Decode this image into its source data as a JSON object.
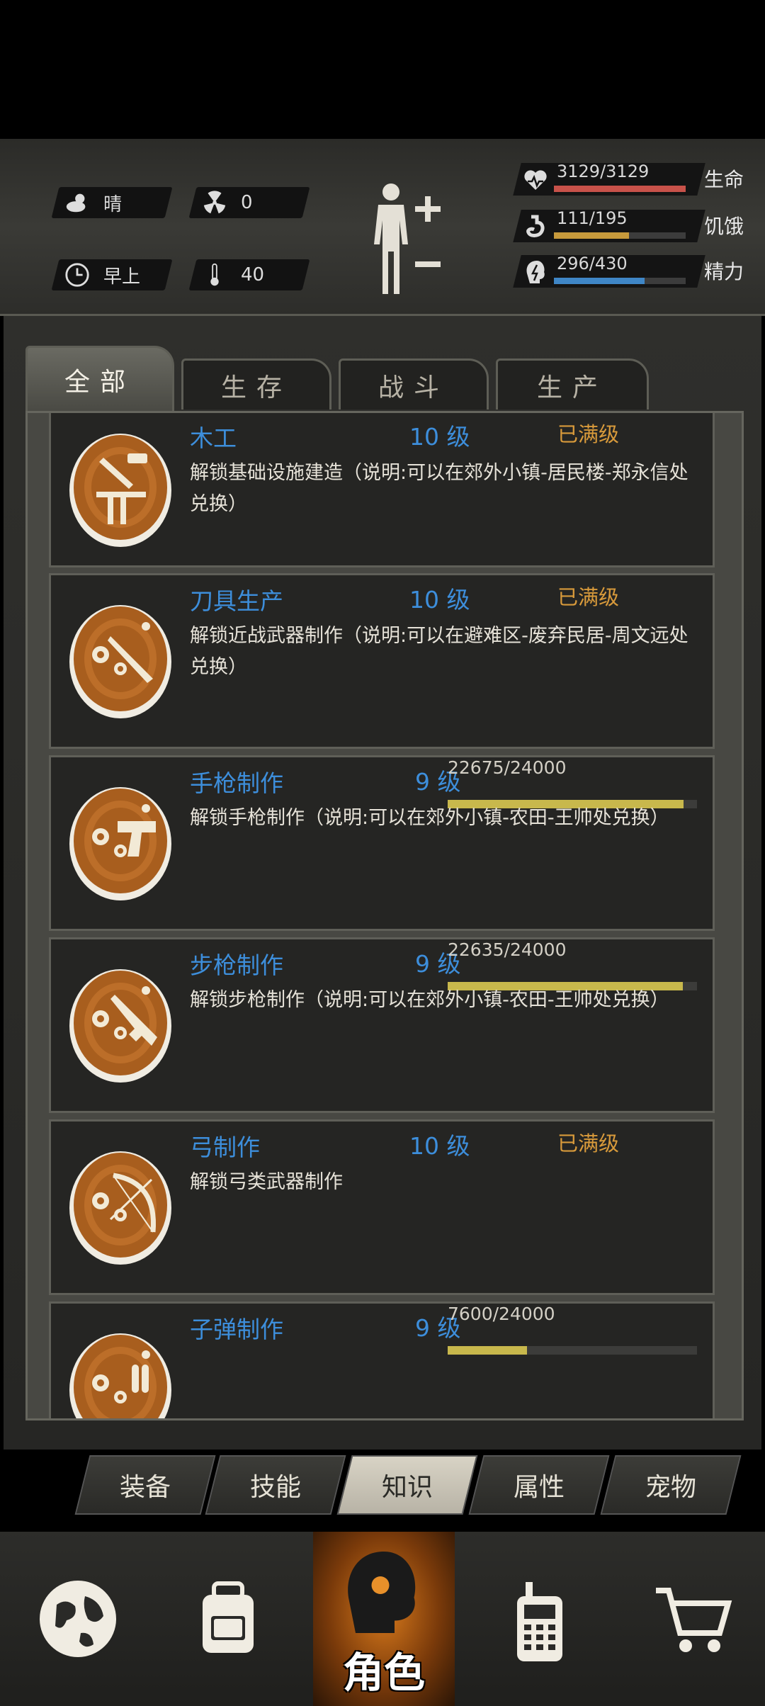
{
  "header": {
    "weather": "晴",
    "radiation": "0",
    "time_of_day": "早上",
    "temperature": "40",
    "stats": [
      {
        "icon": "heart-icon",
        "value": "3129/3129",
        "label": "生命",
        "fraction": 1.0,
        "color": "#c8524a"
      },
      {
        "icon": "stomach-icon",
        "value": "111/195",
        "label": "饥饿",
        "fraction": 0.569,
        "color": "#c79a3c"
      },
      {
        "icon": "energy-icon",
        "value": "296/430",
        "label": "精力",
        "fraction": 0.688,
        "color": "#3f86c6"
      }
    ]
  },
  "tabs": [
    "全部",
    "生存",
    "战斗",
    "生产"
  ],
  "active_tab": "全部",
  "skills": [
    {
      "name": "木工",
      "level": "10 级",
      "status": "已满级",
      "desc": "解锁基础设施建造（说明:可以在郊外小镇-居民楼-郑永信处兑换）",
      "icon": "carpentry-icon"
    },
    {
      "name": "刀具生产",
      "level": "10 级",
      "status": "已满级",
      "desc": "解锁近战武器制作（说明:可以在避难区-废弃民居-周文远处兑换）",
      "icon": "knife-crafting-icon"
    },
    {
      "name": "手枪制作",
      "level": "9 级",
      "xp": "22675/24000",
      "progress": 0.945,
      "desc": "解锁手枪制作（说明:可以在郊外小镇-农田-王帅处兑换）",
      "icon": "pistol-crafting-icon"
    },
    {
      "name": "步枪制作",
      "level": "9 级",
      "xp": "22635/24000",
      "progress": 0.943,
      "desc": "解锁步枪制作（说明:可以在郊外小镇-农田-王帅处兑换）",
      "icon": "rifle-crafting-icon"
    },
    {
      "name": "弓制作",
      "level": "10 级",
      "status": "已满级",
      "desc": "解锁弓类武器制作",
      "icon": "bow-crafting-icon"
    },
    {
      "name": "子弹制作",
      "level": "9 级",
      "xp": "7600/24000",
      "progress": 0.317,
      "desc": "",
      "icon": "bullet-crafting-icon"
    }
  ],
  "sub_tabs": [
    "装备",
    "技能",
    "知识",
    "属性",
    "宠物"
  ],
  "active_sub_tab": "知识",
  "nav": {
    "items": [
      "globe-icon",
      "backpack-icon",
      "character-icon",
      "radio-icon",
      "cart-icon"
    ],
    "active_label": "角色"
  }
}
